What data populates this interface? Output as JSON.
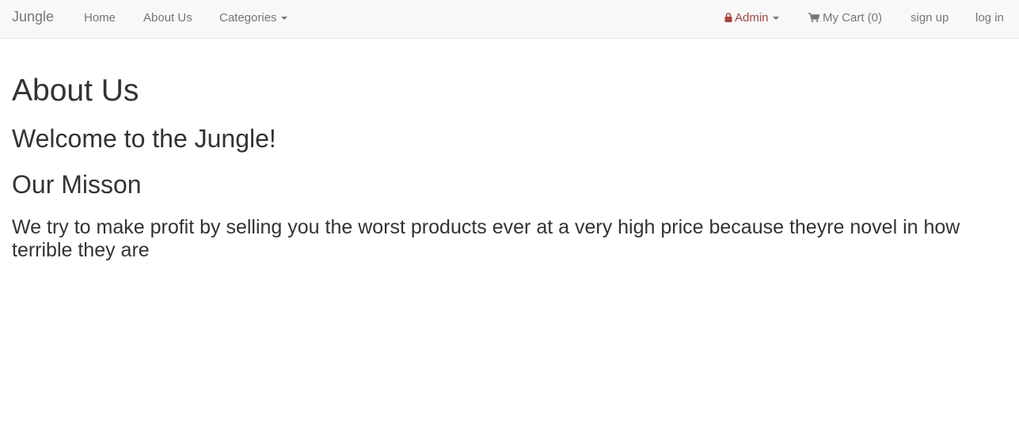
{
  "navbar": {
    "brand": "Jungle",
    "left_links": [
      "Home",
      "About Us",
      "Categories"
    ],
    "admin_label": "Admin",
    "cart_label": "My Cart (0)",
    "signup_label": "sign up",
    "login_label": "log in",
    "icons": {
      "lock": "lock-icon",
      "cart": "shopping-cart-icon",
      "caret": "caret-down-icon"
    },
    "colors": {
      "background": "#f8f8f8",
      "link": "#777777",
      "admin": "#a94442"
    }
  },
  "page": {
    "title": "About Us",
    "welcome": "Welcome to the Jungle!",
    "mission_heading": "Our Misson",
    "mission_text": "We try to make profit by selling you the worst products ever at a very high price because theyre novel in how terrible they are"
  }
}
